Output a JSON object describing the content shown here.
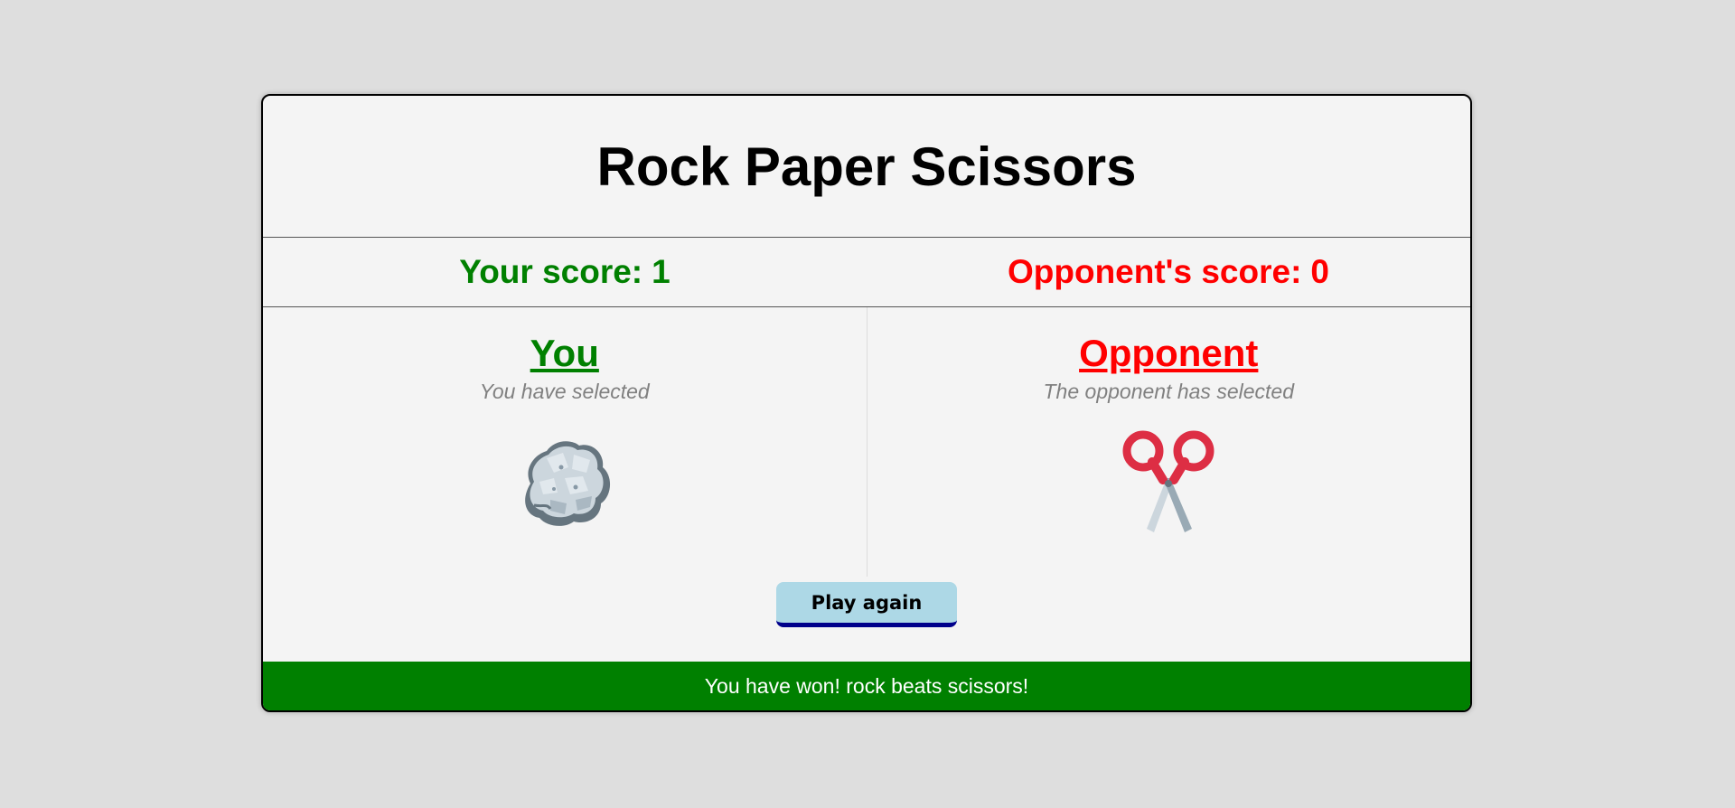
{
  "title": "Rock Paper Scissors",
  "scores": {
    "you_label": "Your score:",
    "you_value": "1",
    "opponent_label": "Opponent's score:",
    "opponent_value": "0"
  },
  "you": {
    "heading": "You",
    "subtitle": "You have selected",
    "choice_icon": "rock-icon"
  },
  "opponent": {
    "heading": "Opponent",
    "subtitle": "The opponent has selected",
    "choice_icon": "scissors-icon"
  },
  "play_again_label": "Play again",
  "result_message": "You have won! rock beats scissors!",
  "colors": {
    "you": "#008000",
    "opponent": "#ff0000",
    "result_bar": "#008000",
    "button": "#add8e6",
    "button_border": "#00008b"
  }
}
